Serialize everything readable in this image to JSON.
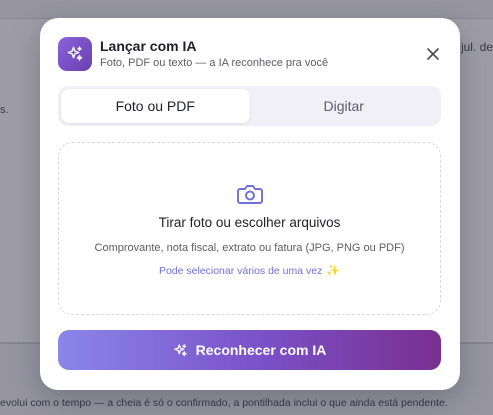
{
  "background": {
    "top_right_text": "jul. de",
    "left_text": "s.",
    "footer_text": "evolui com o tempo — a cheia é só o confirmado, a pontilhada inclui o que ainda está pendente."
  },
  "modal": {
    "title": "Lançar com IA",
    "subtitle": "Foto, PDF ou texto — a IA reconhece pra você",
    "icon": "sparkles-icon",
    "close_icon": "close-icon"
  },
  "tabs": [
    {
      "label": "Foto ou PDF",
      "active": true
    },
    {
      "label": "Digitar",
      "active": false
    }
  ],
  "dropzone": {
    "icon": "camera-icon",
    "title": "Tirar foto ou escolher arquivos",
    "description": "Comprovante, nota fiscal, extrato ou fatura (JPG, PNG ou PDF)",
    "multi_hint": "Pode selecionar vários de uma vez",
    "multi_hint_icon": "✨"
  },
  "cta": {
    "label": "Reconhecer com IA",
    "icon": "sparkles-icon"
  },
  "colors": {
    "accent": "#7a4fc6",
    "link": "#7270d8",
    "gradient_start": "#8a86ea",
    "gradient_end": "#7a2f8f"
  }
}
